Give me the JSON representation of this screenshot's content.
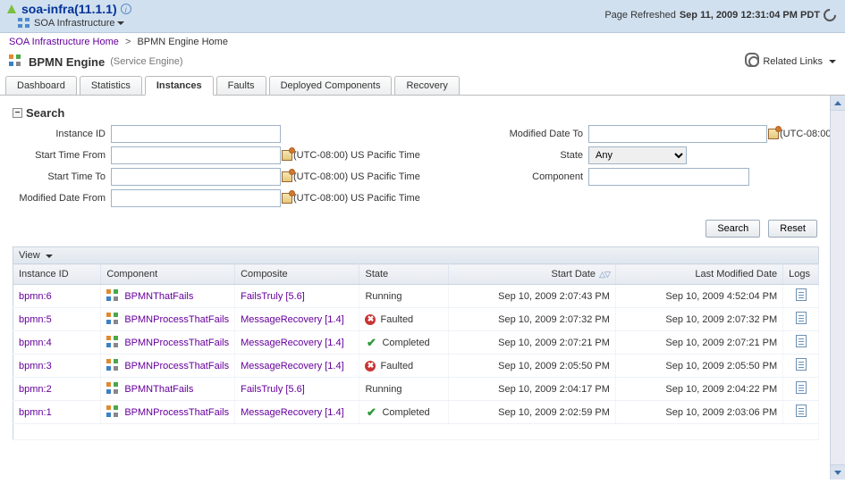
{
  "header": {
    "title": "soa-infra(11.1.1)",
    "subtitle": "SOA Infrastructure",
    "page_refreshed_label": "Page Refreshed",
    "page_refreshed_time": "Sep 11, 2009 12:31:04 PM PDT"
  },
  "breadcrumb": {
    "items": [
      "SOA Infrastructure Home"
    ],
    "current": "BPMN Engine Home"
  },
  "engine": {
    "title": "BPMN Engine",
    "subtitle": "(Service Engine)",
    "related_links": "Related Links"
  },
  "tabs": {
    "items": [
      "Dashboard",
      "Statistics",
      "Instances",
      "Faults",
      "Deployed Components",
      "Recovery"
    ],
    "active": "Instances"
  },
  "search": {
    "heading": "Search",
    "labels": {
      "instance_id": "Instance ID",
      "start_from": "Start Time From",
      "start_to": "Start Time To",
      "mod_from": "Modified Date From",
      "mod_to": "Modified Date To",
      "state": "State",
      "component": "Component",
      "tz": "(UTC-08:00) US Pacific Time"
    },
    "state_selected": "Any",
    "buttons": {
      "search": "Search",
      "reset": "Reset"
    }
  },
  "view_label": "View",
  "table": {
    "cols": {
      "instance_id": "Instance ID",
      "component": "Component",
      "composite": "Composite",
      "state": "State",
      "start_date": "Start Date",
      "last_mod": "Last Modified Date",
      "logs": "Logs"
    },
    "rows": [
      {
        "id": "bpmn:6",
        "component": "BPMNThatFails",
        "composite": "FailsTruly [5.6]",
        "state": "Running",
        "state_icon": "",
        "start": "Sep 10, 2009 2:07:43 PM",
        "mod": "Sep 10, 2009 4:52:04 PM"
      },
      {
        "id": "bpmn:5",
        "component": "BPMNProcessThatFails",
        "composite": "MessageRecovery [1.4]",
        "state": "Faulted",
        "state_icon": "faulted",
        "start": "Sep 10, 2009 2:07:32 PM",
        "mod": "Sep 10, 2009 2:07:32 PM"
      },
      {
        "id": "bpmn:4",
        "component": "BPMNProcessThatFails",
        "composite": "MessageRecovery [1.4]",
        "state": "Completed",
        "state_icon": "completed",
        "start": "Sep 10, 2009 2:07:21 PM",
        "mod": "Sep 10, 2009 2:07:21 PM"
      },
      {
        "id": "bpmn:3",
        "component": "BPMNProcessThatFails",
        "composite": "MessageRecovery [1.4]",
        "state": "Faulted",
        "state_icon": "faulted",
        "start": "Sep 10, 2009 2:05:50 PM",
        "mod": "Sep 10, 2009 2:05:50 PM"
      },
      {
        "id": "bpmn:2",
        "component": "BPMNThatFails",
        "composite": "FailsTruly [5.6]",
        "state": "Running",
        "state_icon": "",
        "start": "Sep 10, 2009 2:04:17 PM",
        "mod": "Sep 10, 2009 2:04:22 PM"
      },
      {
        "id": "bpmn:1",
        "component": "BPMNProcessThatFails",
        "composite": "MessageRecovery [1.4]",
        "state": "Completed",
        "state_icon": "completed",
        "start": "Sep 10, 2009 2:02:59 PM",
        "mod": "Sep 10, 2009 2:03:06 PM"
      }
    ]
  }
}
